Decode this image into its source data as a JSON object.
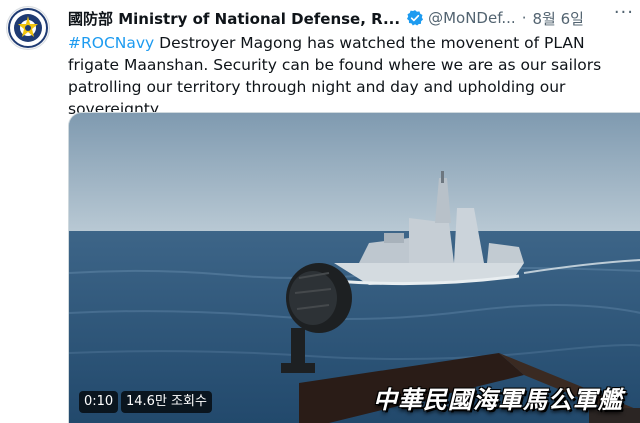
{
  "tweet": {
    "author_name": "國防部 Ministry of National Defense, R...",
    "handle": "@MoNDef...",
    "separator": "·",
    "date": "8월 6일",
    "more": "···",
    "hashtag": "#ROCNavy",
    "body": " Destroyer Magong has watched the movenent of PLAN frigate Maanshan. Security can be found where we are as our sailors patrolling our territory through night and day and upholding our sovereignty."
  },
  "video": {
    "time": "0:10",
    "views": "14.6만 조회수",
    "caption": "中華民國海軍馬公軍艦"
  },
  "colors": {
    "accent": "#1d9bf0",
    "text": "#0f1419",
    "muted": "#536471"
  }
}
